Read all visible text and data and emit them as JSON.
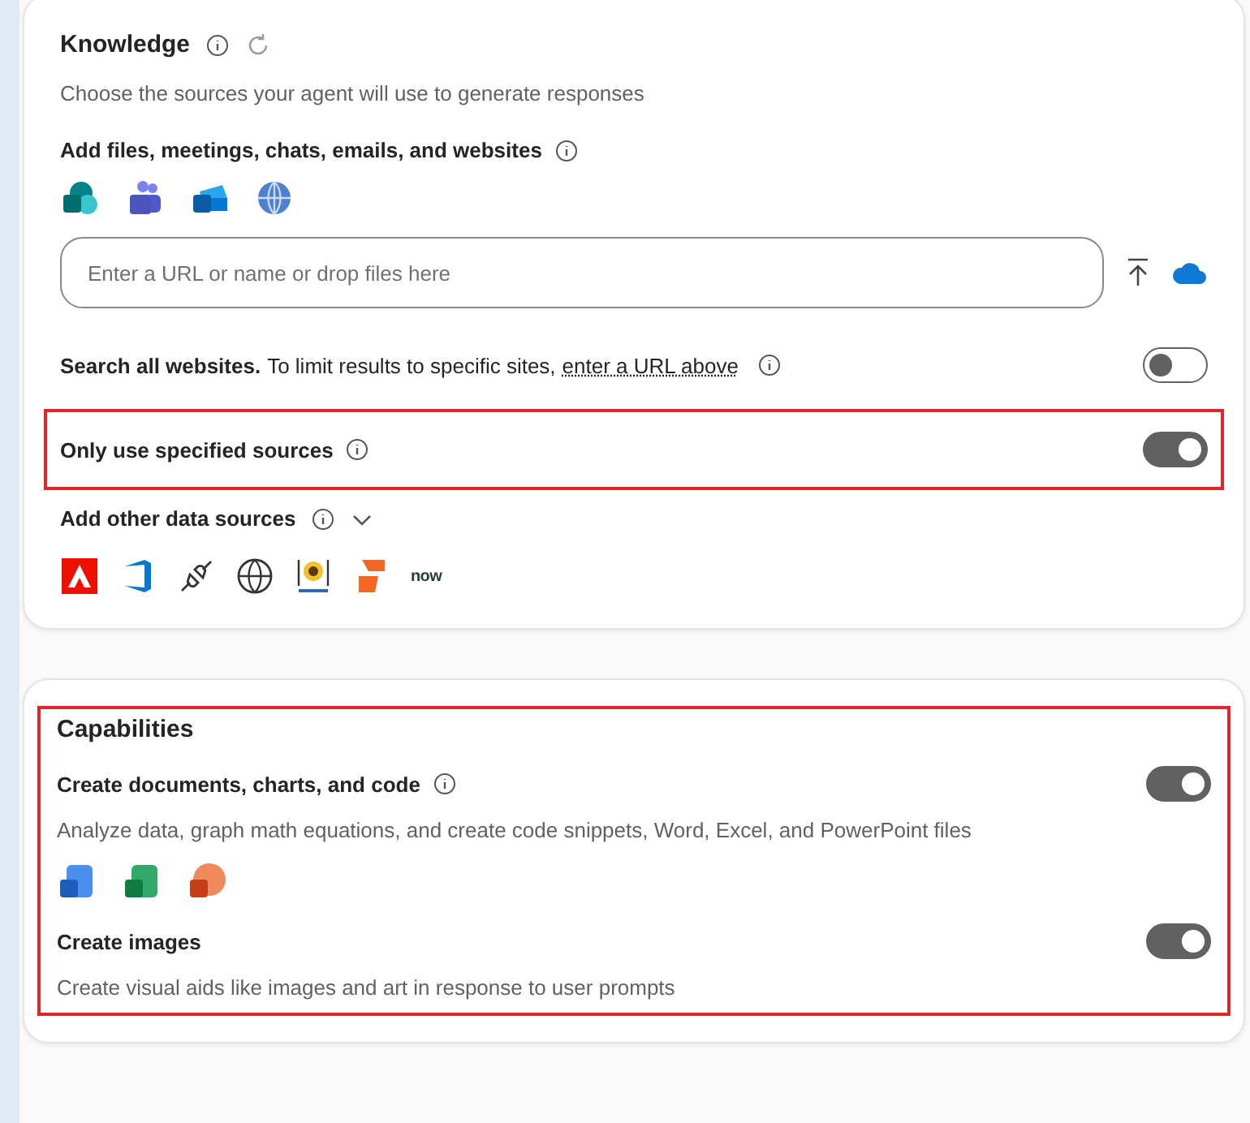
{
  "knowledge": {
    "title": "Knowledge",
    "description": "Choose the sources your agent will use to generate responses",
    "add_files": {
      "label": "Add files, meetings, chats, emails, and websites"
    },
    "url_field": {
      "placeholder": "Enter a URL or name or drop files here"
    },
    "search_all": {
      "lead": "Search all websites.",
      "text": "To limit results to specific sites,",
      "link": "enter a URL above",
      "on": false
    },
    "only_specified": {
      "label": "Only use specified sources",
      "on": true,
      "highlighted": true
    },
    "other_sources": {
      "label": "Add other data sources",
      "expanded": false,
      "now_logo": "now"
    }
  },
  "capabilities": {
    "title": "Capabilities",
    "highlighted": true,
    "items": [
      {
        "title": "Create documents, charts, and code",
        "info": true,
        "on": true,
        "description": "Analyze data, graph math equations, and create code snippets, Word, Excel, and PowerPoint files",
        "kind": "office"
      },
      {
        "title": "Create images",
        "info": false,
        "on": true,
        "description": "Create visual aids like images and art in response to user prompts",
        "kind": "plain"
      }
    ]
  }
}
